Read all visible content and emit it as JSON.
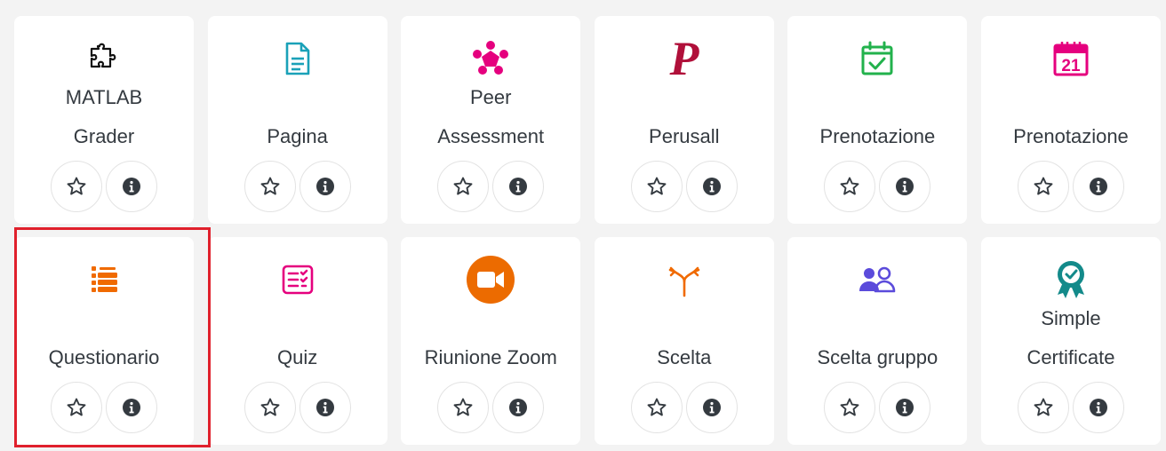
{
  "modules": [
    {
      "id": "matlab-grader",
      "label_lines": [
        "MATLAB",
        "Grader"
      ],
      "icon": "puzzle-icon",
      "icon_color": "#111111"
    },
    {
      "id": "pagina",
      "label_lines": [
        "Pagina"
      ],
      "icon": "document-icon",
      "icon_color": "#1aa1b8"
    },
    {
      "id": "peer-assessment",
      "label_lines": [
        "Peer",
        "Assessment"
      ],
      "icon": "people-circle-icon",
      "icon_color": "#e5007e"
    },
    {
      "id": "perusall",
      "label_lines": [
        "Perusall"
      ],
      "icon": "perusall-logo-icon",
      "icon_color": "#b0103a"
    },
    {
      "id": "prenotazione-1",
      "label_lines": [
        "Prenotazione"
      ],
      "icon": "calendar-check-icon",
      "icon_color": "#22b24c"
    },
    {
      "id": "prenotazione-2",
      "label_lines": [
        "Prenotazione"
      ],
      "icon": "calendar-date-icon",
      "icon_color": "#e5007e",
      "icon_text": "21"
    },
    {
      "id": "questionario",
      "label_lines": [
        "Questionario"
      ],
      "icon": "list-icon",
      "icon_color": "#f06a00"
    },
    {
      "id": "quiz",
      "label_lines": [
        "Quiz"
      ],
      "icon": "quiz-icon",
      "icon_color": "#e5007e"
    },
    {
      "id": "riunione-zoom",
      "label_lines": [
        "Riunione Zoom"
      ],
      "icon": "video-camera-icon",
      "icon_color": "#ec6b00"
    },
    {
      "id": "scelta",
      "label_lines": [
        "Scelta"
      ],
      "icon": "split-arrows-icon",
      "icon_color": "#f06a00"
    },
    {
      "id": "scelta-gruppo",
      "label_lines": [
        "Scelta gruppo"
      ],
      "icon": "users-icon",
      "icon_color": "#5b4bdb"
    },
    {
      "id": "simple-certificate",
      "label_lines": [
        "Simple",
        "Certificate"
      ],
      "icon": "award-badge-icon",
      "icon_color": "#138a8a"
    }
  ],
  "actions": {
    "favourite_icon": "star-outline-icon",
    "info_icon": "info-icon",
    "icon_color": "#343a40"
  },
  "highlight_color": "#e0202c"
}
